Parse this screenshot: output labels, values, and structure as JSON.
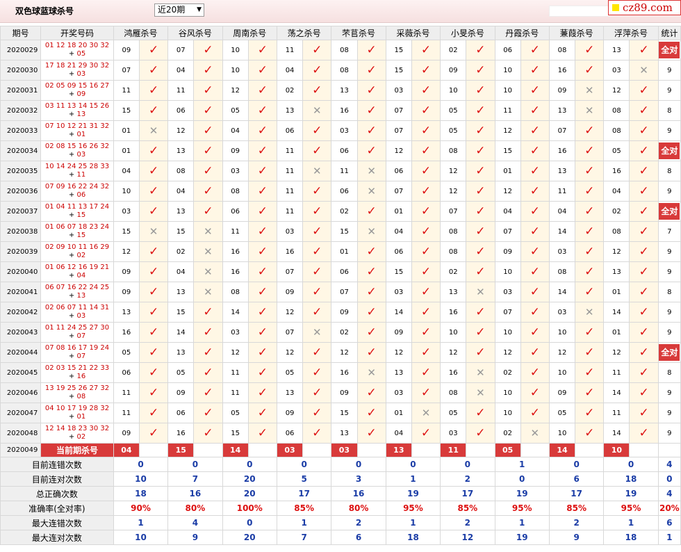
{
  "header": {
    "title": "双色球蓝球杀号",
    "period_selected": "近20期",
    "logo_text": "cz89.com"
  },
  "columns": {
    "issue": "期号",
    "numbers": "开奖号码",
    "experts": [
      "鸿雁杀号",
      "谷风杀号",
      "周南杀号",
      "荡之杀号",
      "芣苢杀号",
      "采薇杀号",
      "小旻杀号",
      "丹霞杀号",
      "蒹葭杀号",
      "浮萍杀号"
    ],
    "stats": "统计"
  },
  "allok_label": "全对",
  "rows": [
    {
      "issue": "2020029",
      "reds": "01 12 18 20 30 32",
      "blue": "05",
      "kills": [
        "09",
        "07",
        "10",
        "11",
        "08",
        "15",
        "02",
        "06",
        "08",
        "13"
      ],
      "ok": [
        1,
        1,
        1,
        1,
        1,
        1,
        1,
        1,
        1,
        1
      ],
      "count": "全对"
    },
    {
      "issue": "2020030",
      "reds": "17 18 21 29 30 32",
      "blue": "03",
      "kills": [
        "07",
        "04",
        "10",
        "04",
        "08",
        "15",
        "09",
        "10",
        "16",
        "03"
      ],
      "ok": [
        1,
        1,
        1,
        1,
        1,
        1,
        1,
        1,
        1,
        0
      ],
      "count": "9"
    },
    {
      "issue": "2020031",
      "reds": "02 05 09 15 16 27",
      "blue": "09",
      "kills": [
        "11",
        "11",
        "12",
        "02",
        "13",
        "03",
        "10",
        "10",
        "09",
        "12"
      ],
      "ok": [
        1,
        1,
        1,
        1,
        1,
        1,
        1,
        1,
        0,
        1
      ],
      "count": "9"
    },
    {
      "issue": "2020032",
      "reds": "03 11 13 14 15 26",
      "blue": "13",
      "kills": [
        "15",
        "06",
        "05",
        "13",
        "16",
        "07",
        "05",
        "11",
        "13",
        "08"
      ],
      "ok": [
        1,
        1,
        1,
        0,
        1,
        1,
        1,
        1,
        0,
        1
      ],
      "count": "8"
    },
    {
      "issue": "2020033",
      "reds": "07 10 12 21 31 32",
      "blue": "01",
      "kills": [
        "01",
        "12",
        "04",
        "06",
        "03",
        "07",
        "05",
        "12",
        "07",
        "08"
      ],
      "ok": [
        0,
        1,
        1,
        1,
        1,
        1,
        1,
        1,
        1,
        1
      ],
      "count": "9"
    },
    {
      "issue": "2020034",
      "reds": "02 08 15 16 26 32",
      "blue": "03",
      "kills": [
        "01",
        "13",
        "09",
        "11",
        "06",
        "12",
        "08",
        "15",
        "16",
        "05"
      ],
      "ok": [
        1,
        1,
        1,
        1,
        1,
        1,
        1,
        1,
        1,
        1
      ],
      "count": "全对"
    },
    {
      "issue": "2020035",
      "reds": "10 14 24 25 28 33",
      "blue": "11",
      "kills": [
        "04",
        "08",
        "03",
        "11",
        "11",
        "06",
        "12",
        "01",
        "13",
        "16"
      ],
      "ok": [
        1,
        1,
        1,
        0,
        0,
        1,
        1,
        1,
        1,
        1
      ],
      "count": "8"
    },
    {
      "issue": "2020036",
      "reds": "07 09 16 22 24 32",
      "blue": "06",
      "kills": [
        "10",
        "04",
        "08",
        "11",
        "06",
        "07",
        "12",
        "12",
        "11",
        "04"
      ],
      "ok": [
        1,
        1,
        1,
        1,
        0,
        1,
        1,
        1,
        1,
        1
      ],
      "count": "9"
    },
    {
      "issue": "2020037",
      "reds": "01 04 11 13 17 24",
      "blue": "15",
      "kills": [
        "03",
        "13",
        "06",
        "11",
        "02",
        "01",
        "07",
        "04",
        "04",
        "02"
      ],
      "ok": [
        1,
        1,
        1,
        1,
        1,
        1,
        1,
        1,
        1,
        1
      ],
      "count": "全对"
    },
    {
      "issue": "2020038",
      "reds": "01 06 07 18 23 24",
      "blue": "15",
      "kills": [
        "15",
        "15",
        "11",
        "03",
        "15",
        "04",
        "08",
        "07",
        "14",
        "08"
      ],
      "ok": [
        0,
        0,
        1,
        1,
        0,
        1,
        1,
        1,
        1,
        1
      ],
      "count": "7"
    },
    {
      "issue": "2020039",
      "reds": "02 09 10 11 16 29",
      "blue": "02",
      "kills": [
        "12",
        "02",
        "16",
        "16",
        "01",
        "06",
        "08",
        "09",
        "03",
        "12"
      ],
      "ok": [
        1,
        0,
        1,
        1,
        1,
        1,
        1,
        1,
        1,
        1
      ],
      "count": "9"
    },
    {
      "issue": "2020040",
      "reds": "01 06 12 16 19 21",
      "blue": "04",
      "kills": [
        "09",
        "04",
        "16",
        "07",
        "06",
        "15",
        "02",
        "10",
        "08",
        "13"
      ],
      "ok": [
        1,
        0,
        1,
        1,
        1,
        1,
        1,
        1,
        1,
        1
      ],
      "count": "9"
    },
    {
      "issue": "2020041",
      "reds": "06 07 16 22 24 25",
      "blue": "13",
      "kills": [
        "09",
        "13",
        "08",
        "09",
        "07",
        "03",
        "13",
        "03",
        "14",
        "01"
      ],
      "ok": [
        1,
        0,
        1,
        1,
        1,
        1,
        0,
        1,
        1,
        1
      ],
      "count": "8"
    },
    {
      "issue": "2020042",
      "reds": "02 06 07 11 14 31",
      "blue": "03",
      "kills": [
        "13",
        "15",
        "14",
        "12",
        "09",
        "14",
        "16",
        "07",
        "03",
        "14"
      ],
      "ok": [
        1,
        1,
        1,
        1,
        1,
        1,
        1,
        1,
        0,
        1
      ],
      "count": "9"
    },
    {
      "issue": "2020043",
      "reds": "01 11 24 25 27 30",
      "blue": "07",
      "kills": [
        "16",
        "14",
        "03",
        "07",
        "02",
        "09",
        "10",
        "10",
        "10",
        "01"
      ],
      "ok": [
        1,
        1,
        1,
        0,
        1,
        1,
        1,
        1,
        1,
        1
      ],
      "count": "9"
    },
    {
      "issue": "2020044",
      "reds": "07 08 16 17 19 24",
      "blue": "07",
      "kills": [
        "05",
        "13",
        "12",
        "12",
        "12",
        "12",
        "12",
        "12",
        "12",
        "12"
      ],
      "ok": [
        1,
        1,
        1,
        1,
        1,
        1,
        1,
        1,
        1,
        1
      ],
      "count": "全对"
    },
    {
      "issue": "2020045",
      "reds": "02 03 15 21 22 33",
      "blue": "16",
      "kills": [
        "06",
        "05",
        "11",
        "05",
        "16",
        "13",
        "16",
        "02",
        "10",
        "11"
      ],
      "ok": [
        1,
        1,
        1,
        1,
        0,
        1,
        0,
        1,
        1,
        1
      ],
      "count": "8"
    },
    {
      "issue": "2020046",
      "reds": "13 19 25 26 27 32",
      "blue": "08",
      "kills": [
        "11",
        "09",
        "11",
        "13",
        "09",
        "03",
        "08",
        "10",
        "09",
        "14"
      ],
      "ok": [
        1,
        1,
        1,
        1,
        1,
        1,
        0,
        1,
        1,
        1
      ],
      "count": "9"
    },
    {
      "issue": "2020047",
      "reds": "04 10 17 19 28 32",
      "blue": "01",
      "kills": [
        "11",
        "06",
        "05",
        "09",
        "15",
        "01",
        "05",
        "10",
        "05",
        "11"
      ],
      "ok": [
        1,
        1,
        1,
        1,
        1,
        0,
        1,
        1,
        1,
        1
      ],
      "count": "9"
    },
    {
      "issue": "2020048",
      "reds": "12 14 18 23 30 32",
      "blue": "02",
      "kills": [
        "09",
        "16",
        "15",
        "06",
        "13",
        "04",
        "03",
        "02",
        "10",
        "14"
      ],
      "ok": [
        1,
        1,
        1,
        1,
        1,
        1,
        1,
        0,
        1,
        1
      ],
      "count": "9"
    }
  ],
  "current": {
    "issue": "2020049",
    "label": "当前期杀号",
    "kills": [
      "04",
      "15",
      "14",
      "03",
      "03",
      "13",
      "11",
      "05",
      "14",
      "10"
    ]
  },
  "stats": [
    {
      "label": "目前连错次数",
      "values": [
        "0",
        "0",
        "0",
        "0",
        "0",
        "0",
        "0",
        "1",
        "0",
        "0"
      ],
      "total": "4",
      "red": false
    },
    {
      "label": "目前连对次数",
      "values": [
        "10",
        "7",
        "20",
        "5",
        "3",
        "1",
        "2",
        "0",
        "6",
        "18"
      ],
      "total": "0",
      "red": false
    },
    {
      "label": "总正确次数",
      "values": [
        "18",
        "16",
        "20",
        "17",
        "16",
        "19",
        "17",
        "19",
        "17",
        "19"
      ],
      "total": "4",
      "red": false
    },
    {
      "label": "准确率(全对率)",
      "values": [
        "90%",
        "80%",
        "100%",
        "85%",
        "80%",
        "95%",
        "85%",
        "95%",
        "85%",
        "95%"
      ],
      "total": "20%",
      "red": true
    },
    {
      "label": "最大连错次数",
      "values": [
        "1",
        "4",
        "0",
        "1",
        "2",
        "1",
        "2",
        "1",
        "2",
        "1"
      ],
      "total": "6",
      "red": false
    },
    {
      "label": "最大连对次数",
      "values": [
        "10",
        "9",
        "20",
        "7",
        "6",
        "18",
        "12",
        "19",
        "9",
        "18"
      ],
      "total": "1",
      "red": false
    }
  ]
}
